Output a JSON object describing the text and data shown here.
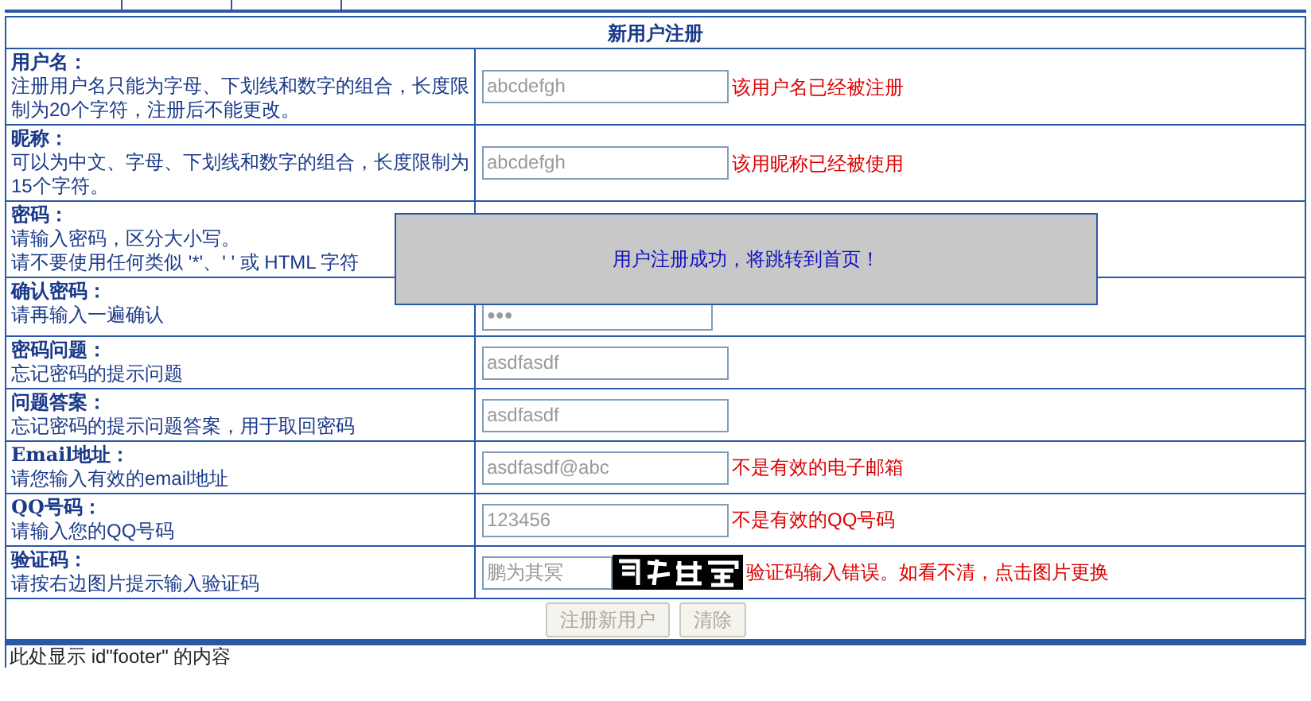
{
  "title": "新用户注册",
  "rows": [
    {
      "label": "用户名：",
      "hint": "注册用户名只能为字母、下划线和数字的组合，长度限制为20个字符，注册后不能更改。",
      "field": {
        "kind": "text",
        "value": "abcdefgh"
      },
      "error": "该用户名已经被注册"
    },
    {
      "label": "昵称：",
      "hint": "可以为中文、字母、下划线和数字的组合，长度限制为15个字符。",
      "field": {
        "kind": "text",
        "value": "abcdefgh"
      },
      "error": "该用昵称已经被使用"
    },
    {
      "label": "密码：",
      "hint": [
        "请输入密码，区分大小写。",
        "请不要使用任何类似 '*'、' ' 或 HTML 字符"
      ],
      "field": {
        "kind": "hidden"
      }
    },
    {
      "label": "确认密码：",
      "hint": "请再输入一遍确认",
      "field": {
        "kind": "password",
        "value": "●●●"
      }
    },
    {
      "label": "密码问题：",
      "hint": "忘记密码的提示问题",
      "field": {
        "kind": "text",
        "value": "asdfasdf"
      }
    },
    {
      "label": "问题答案：",
      "hint": "忘记密码的提示问题答案，用于取回密码",
      "field": {
        "kind": "text",
        "value": "asdfasdf"
      }
    },
    {
      "label": "Email地址：",
      "hint": "请您输入有效的email地址",
      "field": {
        "kind": "text",
        "value": "asdfasdf@abc"
      },
      "error": "不是有效的电子邮箱"
    },
    {
      "label": "QQ号码：",
      "hint": "请输入您的QQ号码",
      "field": {
        "kind": "text",
        "value": "123456"
      },
      "error": "不是有效的QQ号码"
    },
    {
      "label": "验证码：",
      "hint": "请按右边图片提示输入验证码",
      "field": {
        "kind": "captcha",
        "value": "鹏为其冥"
      },
      "error": "验证码输入错误。如看不清，点击图片更换"
    }
  ],
  "buttons": [
    {
      "label": "注册新用户",
      "disabled": true
    },
    {
      "label": "清除",
      "disabled": true
    }
  ],
  "dialog": {
    "message": "用户注册成功，将跳转到首页！"
  },
  "footer": "此处显示 id\"footer\" 的内容"
}
